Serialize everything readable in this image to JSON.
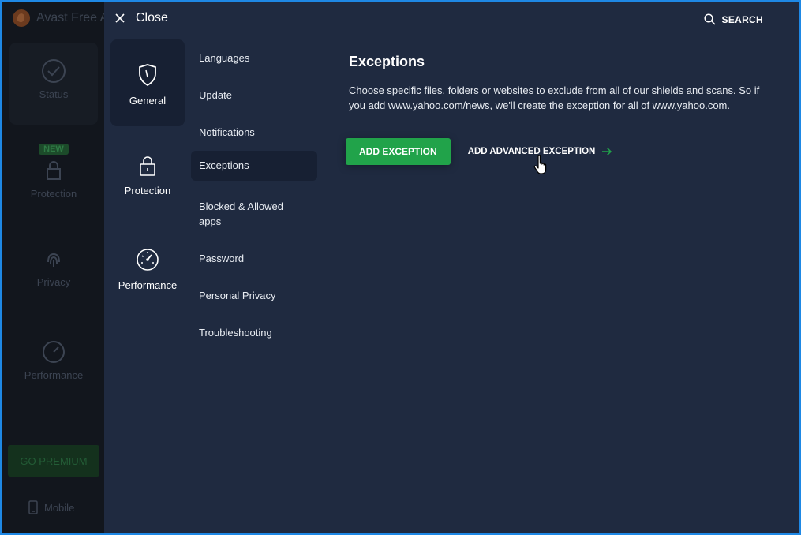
{
  "background_app": {
    "title": "Avast Free A",
    "nav": [
      {
        "label": "Status",
        "icon": "check-circle-icon"
      },
      {
        "label": "Protection",
        "icon": "lock-icon",
        "badge": "NEW"
      },
      {
        "label": "Privacy",
        "icon": "fingerprint-icon"
      },
      {
        "label": "Performance",
        "icon": "gauge-icon"
      }
    ],
    "premium_label": "GO PREMIUM",
    "mobile_label": "Mobile"
  },
  "settings": {
    "close_label": "Close",
    "search_label": "SEARCH",
    "categories": [
      {
        "label": "General",
        "icon": "shield-icon",
        "active": true
      },
      {
        "label": "Protection",
        "icon": "lock-icon"
      },
      {
        "label": "Performance",
        "icon": "gauge-icon"
      }
    ],
    "sub_items": [
      {
        "label": "Languages"
      },
      {
        "label": "Update"
      },
      {
        "label": "Notifications"
      },
      {
        "label": "Exceptions",
        "active": true
      },
      {
        "label": "Blocked & Allowed apps"
      },
      {
        "label": "Password"
      },
      {
        "label": "Personal Privacy"
      },
      {
        "label": "Troubleshooting"
      }
    ],
    "content": {
      "title": "Exceptions",
      "description": "Choose specific files, folders or websites to exclude from all of our shields and scans. So if you add www.yahoo.com/news, we'll create the exception for all of www.yahoo.com.",
      "add_button": "ADD EXCEPTION",
      "advanced_button": "ADD ADVANCED EXCEPTION"
    }
  },
  "colors": {
    "accent_green": "#21a34a",
    "panel_bg": "#1f2a40",
    "selected_bg": "#172033",
    "frame_border": "#1e88e5"
  }
}
